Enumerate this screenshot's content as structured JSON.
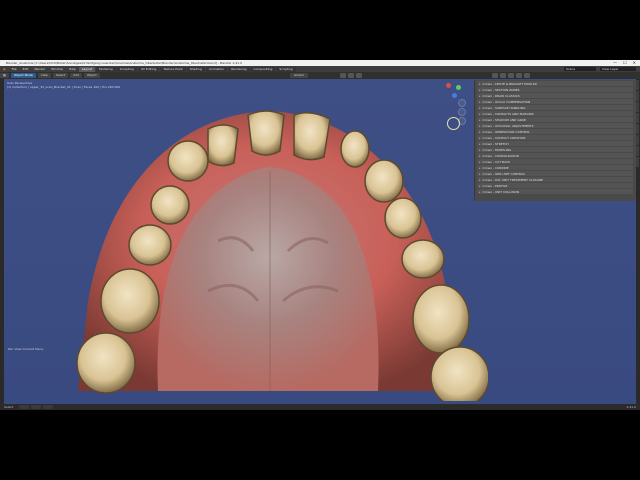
{
  "window": {
    "title": "Blender_Anatomie [C:\\Users\\OCD\\Bilder\\Sonstiges\\Dr.Wolfgang Guender\\Cinemas\\Anatomie_Oberkiefer\\Blender\\Anatomie_Oberkiefer.blend] - Blender 2.91.0",
    "minimize": "—",
    "maximize": "☐",
    "close": "✕"
  },
  "menubar": {
    "items": [
      "File",
      "Edit",
      "Render",
      "Window",
      "Help"
    ],
    "workspaces": [
      "Layout",
      "Modeling",
      "Sculpting",
      "UV Editing",
      "Texture Paint",
      "Shading",
      "Animation",
      "Rendering",
      "Compositing",
      "Scripting"
    ],
    "active_workspace": "Layout",
    "scene": "Scene",
    "view_layer": "View Layer"
  },
  "header3d": {
    "mode": "Object Mode",
    "buttons": [
      "View",
      "Select",
      "Add",
      "Object"
    ],
    "orientation": "Global"
  },
  "viewport": {
    "info_line1": "User Perspective",
    "info_line2": "(1) Collection | upper_3d_scan_Bracket_01 | Scan | Faces 100 | Tris 260 000",
    "bottom_left": "Pan View  Context Menu"
  },
  "addon_panel": {
    "items": [
      "Crown - LEISTE & BRACKET MODULE",
      "Crown - SECTION ZONES",
      "Crown - DRAW CLASSICS",
      "Crown - OCCLU COMPENSATION",
      "Crown - SURFACE HANDLING",
      "Crown - CONTACTS AND MARGINS",
      "Crown - SHADOW AND GRAB",
      "Crown - OCCLUSAL ADJUSTMENTS",
      "Crown - GENERATION CONTROL",
      "Crown - CONTACT CREATION",
      "Crown - STRETCH",
      "Crown - MODELING",
      "Crown - CONSOLIDATOR",
      "Crown - CUT BACK",
      "Crown - CORRIDE",
      "Crown - GEN UNIT CONTROL",
      "Crown - DAY UNIT TREATMENT CLOSURE",
      "Crown - PROFILE",
      "Crown - UNIT COLLISION"
    ]
  },
  "statusbar": {
    "left": "Select",
    "version": "2.91.0"
  },
  "colors": {
    "viewport_bg": "#3d4e84",
    "gum": "#c8645a",
    "tooth": "#e6d2a8",
    "active_tab": "#2d5d8f"
  }
}
